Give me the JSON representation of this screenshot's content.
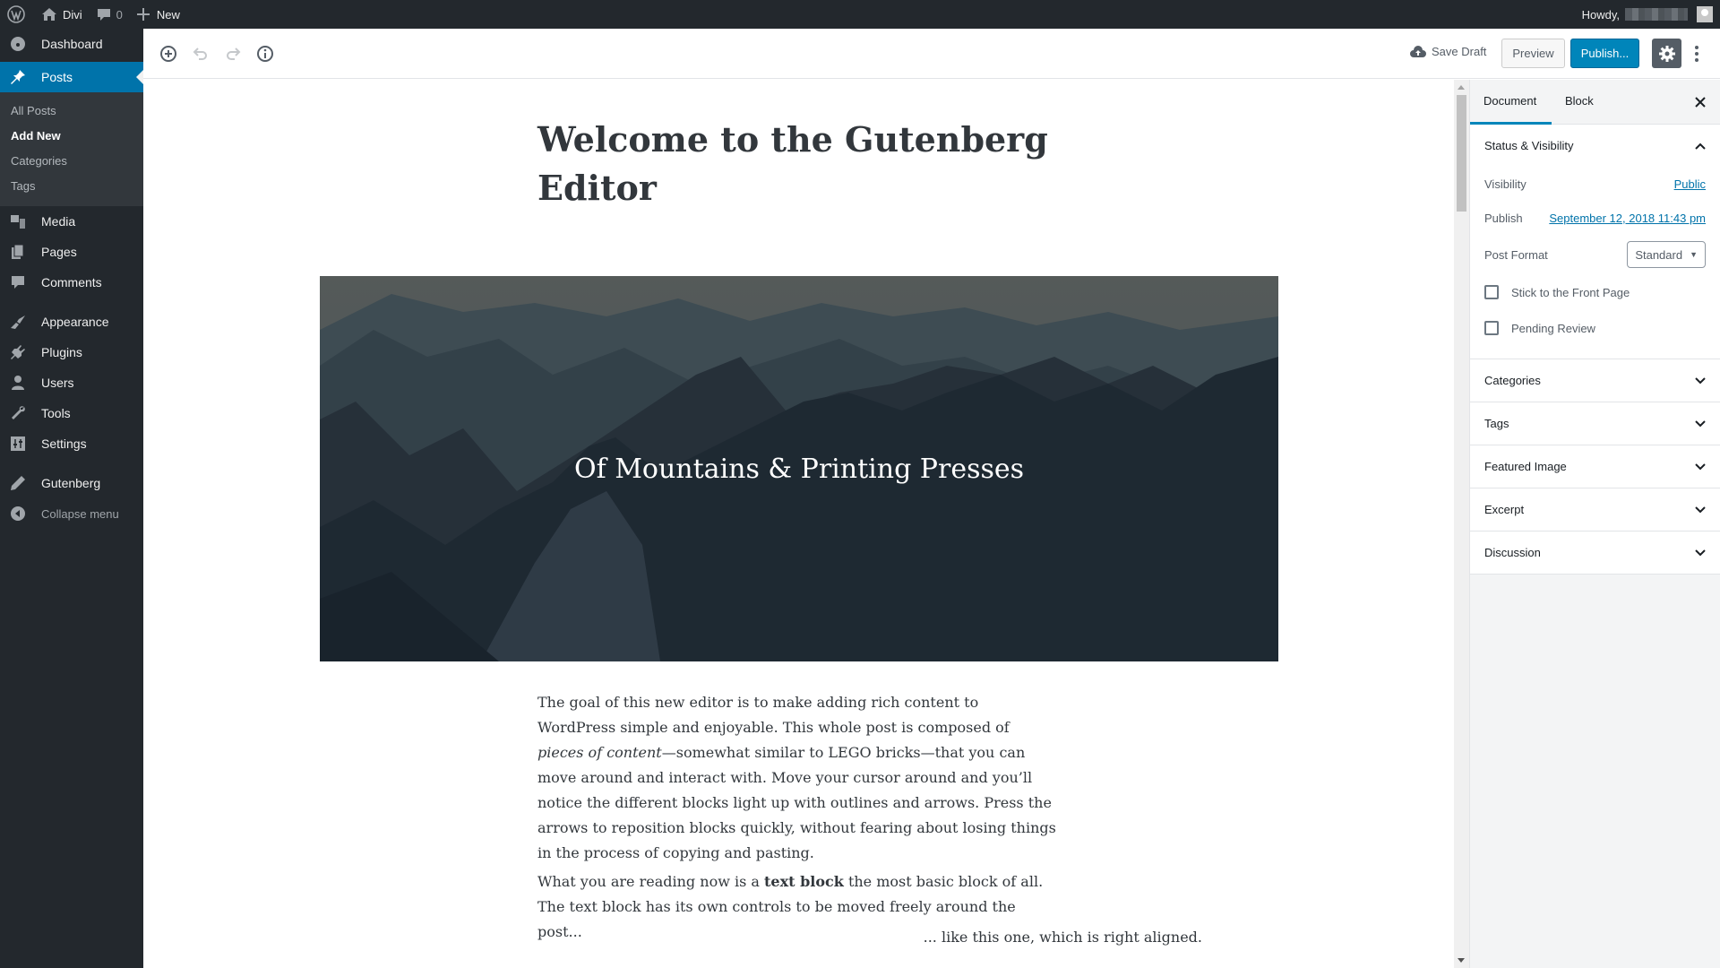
{
  "adminbar": {
    "site_name": "Divi",
    "comments_count": "0",
    "new_label": "New",
    "howdy": "Howdy,"
  },
  "menu": {
    "items": [
      {
        "label": "Dashboard",
        "icon": "dashboard-icon"
      },
      {
        "label": "Posts",
        "icon": "pin-icon",
        "current": true
      },
      {
        "label": "Media",
        "icon": "media-icon"
      },
      {
        "label": "Pages",
        "icon": "pages-icon"
      },
      {
        "label": "Comments",
        "icon": "comment-icon"
      },
      {
        "label": "Appearance",
        "icon": "brush-icon"
      },
      {
        "label": "Plugins",
        "icon": "plug-icon"
      },
      {
        "label": "Users",
        "icon": "user-icon"
      },
      {
        "label": "Tools",
        "icon": "wrench-icon"
      },
      {
        "label": "Settings",
        "icon": "settings-icon"
      },
      {
        "label": "Gutenberg",
        "icon": "pencil-icon"
      }
    ],
    "submenu": [
      "All Posts",
      "Add New",
      "Categories",
      "Tags"
    ],
    "collapse": "Collapse menu"
  },
  "toolbar": {
    "save_draft": "Save Draft",
    "preview": "Preview",
    "publish": "Publish..."
  },
  "post": {
    "title": "Welcome to the Gutenberg Editor",
    "cover_title": "Of Mountains & Printing Presses",
    "p1_a": "The goal of this new editor is to make adding rich content to WordPress simple and enjoyable. This whole post is composed of ",
    "p1_em": "pieces of content",
    "p1_b": "—somewhat similar to LEGO bricks—that you can move around and interact with. Move your cursor around and you’ll notice the different blocks light up with outlines and arrows. Press the arrows to reposition blocks quickly, without fearing about losing things in the process of copying and pasting.",
    "p2_a": "What you are reading now is a ",
    "p2_strong": "text block",
    "p2_b": " the most basic block of all. The text block has its own controls to be moved freely around the post...",
    "p3": "... like this one, which is right aligned."
  },
  "sidebar": {
    "tabs": [
      "Document",
      "Block"
    ],
    "status_panel": {
      "title": "Status & Visibility",
      "visibility_label": "Visibility",
      "visibility_value": "Public",
      "publish_label": "Publish",
      "publish_value": "September 12, 2018 11:43 pm",
      "format_label": "Post Format",
      "format_value": "Standard",
      "sticky_label": "Stick to the Front Page",
      "pending_label": "Pending Review"
    },
    "panels": [
      "Categories",
      "Tags",
      "Featured Image",
      "Excerpt",
      "Discussion"
    ]
  },
  "colors": {
    "accent": "#0073aa",
    "publish": "#0085ba",
    "adminbar": "#23282d"
  }
}
